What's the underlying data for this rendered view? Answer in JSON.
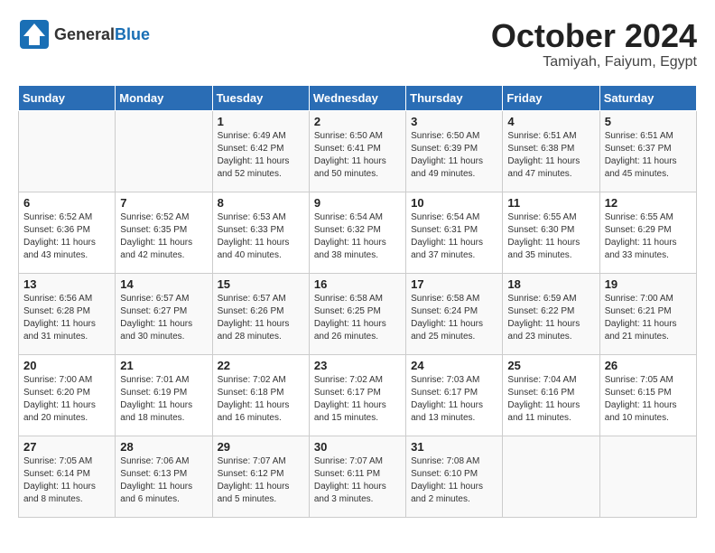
{
  "header": {
    "logo_general": "General",
    "logo_blue": "Blue",
    "month_year": "October 2024",
    "location": "Tamiyah, Faiyum, Egypt"
  },
  "days_of_week": [
    "Sunday",
    "Monday",
    "Tuesday",
    "Wednesday",
    "Thursday",
    "Friday",
    "Saturday"
  ],
  "weeks": [
    [
      {
        "day": null
      },
      {
        "day": null
      },
      {
        "day": 1,
        "sunrise": "Sunrise: 6:49 AM",
        "sunset": "Sunset: 6:42 PM",
        "daylight": "Daylight: 11 hours and 52 minutes."
      },
      {
        "day": 2,
        "sunrise": "Sunrise: 6:50 AM",
        "sunset": "Sunset: 6:41 PM",
        "daylight": "Daylight: 11 hours and 50 minutes."
      },
      {
        "day": 3,
        "sunrise": "Sunrise: 6:50 AM",
        "sunset": "Sunset: 6:39 PM",
        "daylight": "Daylight: 11 hours and 49 minutes."
      },
      {
        "day": 4,
        "sunrise": "Sunrise: 6:51 AM",
        "sunset": "Sunset: 6:38 PM",
        "daylight": "Daylight: 11 hours and 47 minutes."
      },
      {
        "day": 5,
        "sunrise": "Sunrise: 6:51 AM",
        "sunset": "Sunset: 6:37 PM",
        "daylight": "Daylight: 11 hours and 45 minutes."
      }
    ],
    [
      {
        "day": 6,
        "sunrise": "Sunrise: 6:52 AM",
        "sunset": "Sunset: 6:36 PM",
        "daylight": "Daylight: 11 hours and 43 minutes."
      },
      {
        "day": 7,
        "sunrise": "Sunrise: 6:52 AM",
        "sunset": "Sunset: 6:35 PM",
        "daylight": "Daylight: 11 hours and 42 minutes."
      },
      {
        "day": 8,
        "sunrise": "Sunrise: 6:53 AM",
        "sunset": "Sunset: 6:33 PM",
        "daylight": "Daylight: 11 hours and 40 minutes."
      },
      {
        "day": 9,
        "sunrise": "Sunrise: 6:54 AM",
        "sunset": "Sunset: 6:32 PM",
        "daylight": "Daylight: 11 hours and 38 minutes."
      },
      {
        "day": 10,
        "sunrise": "Sunrise: 6:54 AM",
        "sunset": "Sunset: 6:31 PM",
        "daylight": "Daylight: 11 hours and 37 minutes."
      },
      {
        "day": 11,
        "sunrise": "Sunrise: 6:55 AM",
        "sunset": "Sunset: 6:30 PM",
        "daylight": "Daylight: 11 hours and 35 minutes."
      },
      {
        "day": 12,
        "sunrise": "Sunrise: 6:55 AM",
        "sunset": "Sunset: 6:29 PM",
        "daylight": "Daylight: 11 hours and 33 minutes."
      }
    ],
    [
      {
        "day": 13,
        "sunrise": "Sunrise: 6:56 AM",
        "sunset": "Sunset: 6:28 PM",
        "daylight": "Daylight: 11 hours and 31 minutes."
      },
      {
        "day": 14,
        "sunrise": "Sunrise: 6:57 AM",
        "sunset": "Sunset: 6:27 PM",
        "daylight": "Daylight: 11 hours and 30 minutes."
      },
      {
        "day": 15,
        "sunrise": "Sunrise: 6:57 AM",
        "sunset": "Sunset: 6:26 PM",
        "daylight": "Daylight: 11 hours and 28 minutes."
      },
      {
        "day": 16,
        "sunrise": "Sunrise: 6:58 AM",
        "sunset": "Sunset: 6:25 PM",
        "daylight": "Daylight: 11 hours and 26 minutes."
      },
      {
        "day": 17,
        "sunrise": "Sunrise: 6:58 AM",
        "sunset": "Sunset: 6:24 PM",
        "daylight": "Daylight: 11 hours and 25 minutes."
      },
      {
        "day": 18,
        "sunrise": "Sunrise: 6:59 AM",
        "sunset": "Sunset: 6:22 PM",
        "daylight": "Daylight: 11 hours and 23 minutes."
      },
      {
        "day": 19,
        "sunrise": "Sunrise: 7:00 AM",
        "sunset": "Sunset: 6:21 PM",
        "daylight": "Daylight: 11 hours and 21 minutes."
      }
    ],
    [
      {
        "day": 20,
        "sunrise": "Sunrise: 7:00 AM",
        "sunset": "Sunset: 6:20 PM",
        "daylight": "Daylight: 11 hours and 20 minutes."
      },
      {
        "day": 21,
        "sunrise": "Sunrise: 7:01 AM",
        "sunset": "Sunset: 6:19 PM",
        "daylight": "Daylight: 11 hours and 18 minutes."
      },
      {
        "day": 22,
        "sunrise": "Sunrise: 7:02 AM",
        "sunset": "Sunset: 6:18 PM",
        "daylight": "Daylight: 11 hours and 16 minutes."
      },
      {
        "day": 23,
        "sunrise": "Sunrise: 7:02 AM",
        "sunset": "Sunset: 6:17 PM",
        "daylight": "Daylight: 11 hours and 15 minutes."
      },
      {
        "day": 24,
        "sunrise": "Sunrise: 7:03 AM",
        "sunset": "Sunset: 6:17 PM",
        "daylight": "Daylight: 11 hours and 13 minutes."
      },
      {
        "day": 25,
        "sunrise": "Sunrise: 7:04 AM",
        "sunset": "Sunset: 6:16 PM",
        "daylight": "Daylight: 11 hours and 11 minutes."
      },
      {
        "day": 26,
        "sunrise": "Sunrise: 7:05 AM",
        "sunset": "Sunset: 6:15 PM",
        "daylight": "Daylight: 11 hours and 10 minutes."
      }
    ],
    [
      {
        "day": 27,
        "sunrise": "Sunrise: 7:05 AM",
        "sunset": "Sunset: 6:14 PM",
        "daylight": "Daylight: 11 hours and 8 minutes."
      },
      {
        "day": 28,
        "sunrise": "Sunrise: 7:06 AM",
        "sunset": "Sunset: 6:13 PM",
        "daylight": "Daylight: 11 hours and 6 minutes."
      },
      {
        "day": 29,
        "sunrise": "Sunrise: 7:07 AM",
        "sunset": "Sunset: 6:12 PM",
        "daylight": "Daylight: 11 hours and 5 minutes."
      },
      {
        "day": 30,
        "sunrise": "Sunrise: 7:07 AM",
        "sunset": "Sunset: 6:11 PM",
        "daylight": "Daylight: 11 hours and 3 minutes."
      },
      {
        "day": 31,
        "sunrise": "Sunrise: 7:08 AM",
        "sunset": "Sunset: 6:10 PM",
        "daylight": "Daylight: 11 hours and 2 minutes."
      },
      {
        "day": null
      },
      {
        "day": null
      }
    ]
  ]
}
